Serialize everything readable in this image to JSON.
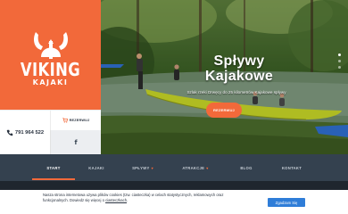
{
  "brand": {
    "name": "VIKING",
    "sub": "KAJAKI",
    "color": "#f2693a"
  },
  "contact": {
    "phone": "791 964 522",
    "reserve_label": "REZERWUJ",
    "facebook_label": "f"
  },
  "hero": {
    "title_line1": "Spływy",
    "title_line2": "Kajakowe",
    "subtitle": "Szlak rzeki Drwęcy do 25 kilometrów Kajakowe spływy",
    "button_label": "REZERWUJ",
    "slides": 3,
    "active_slide": 1
  },
  "nav": {
    "items": [
      {
        "label": "START",
        "active": true,
        "dropdown": false
      },
      {
        "label": "KAJAKI",
        "active": false,
        "dropdown": false
      },
      {
        "label": "SPŁYWY",
        "active": false,
        "dropdown": true
      },
      {
        "label": "ATRAKCJE",
        "active": false,
        "dropdown": true
      },
      {
        "label": "BLOG",
        "active": false,
        "dropdown": false
      },
      {
        "label": "KONTAKT",
        "active": false,
        "dropdown": false
      }
    ],
    "caret": "▾"
  },
  "cookie": {
    "text": "Nasza strona internetowa używa plików cookies (tzw. ciasteczka) w celach statystycznych, reklamowych oraz funkcjonalnych. Dowiedz się więcej o",
    "link_label": "ciasteczkach",
    "accept_label": "Zgadzam Się"
  },
  "icons": {
    "phone": "phone-icon",
    "cart": "cart-icon",
    "facebook": "facebook-icon",
    "logo": "viking-helmet-icon"
  }
}
